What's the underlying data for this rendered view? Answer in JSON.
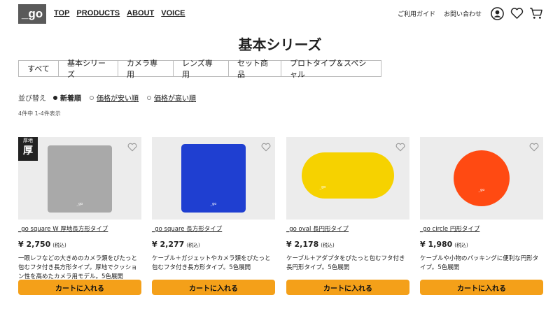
{
  "header": {
    "logo": "_go",
    "nav": [
      "TOP",
      "PRODUCTS",
      "ABOUT",
      "VOICE"
    ],
    "guide": "ご利用ガイド",
    "contact": "お問い合わせ"
  },
  "page_title": "基本シリーズ",
  "tabs": [
    "すべて",
    "基本シリーズ",
    "カメラ専用",
    "レンズ専用",
    "セット商品",
    "プロトタイプ＆スペシャル"
  ],
  "sort": {
    "label": "並び替え",
    "options": [
      "新着順",
      "価格が安い順",
      "価格が高い順"
    ],
    "active": 0
  },
  "result_count": "4件中 1-4件表示",
  "cart_label": "カートに入れる",
  "tax_label": "(税込)",
  "products": [
    {
      "name": "_go square W 厚地長方形タイプ",
      "price": "¥ 2,750",
      "desc": "一眼レフなどの大きめのカメラ類をぴたっと包むフタ付き長方形タイプ。厚地でクッション性を高めたカメラ用モデル。5色展開",
      "color": "#a9a9a9",
      "shape": "square",
      "badge_top": "厚地",
      "badge_main": "厚"
    },
    {
      "name": "_go square 長方形タイプ",
      "price": "¥ 2,277",
      "desc": "ケーブル＋ガジェットやカメラ類をぴたっと包むフタ付き長方形タイプ。5色展開",
      "color": "#1f3fd1",
      "shape": "square"
    },
    {
      "name": "_go oval 長円形タイプ",
      "price": "¥ 2,178",
      "desc": "ケーブル＋アダプタをぴたっと包むフタ付き長円形タイプ。5色展開",
      "color": "#f6d200",
      "shape": "oval"
    },
    {
      "name": "_go circle 円形タイプ",
      "price": "¥ 1,980",
      "desc": "ケーブルや小物のパッキングに便利な円形タイプ。5色展開",
      "color": "#ff4a12",
      "shape": "circle"
    }
  ]
}
